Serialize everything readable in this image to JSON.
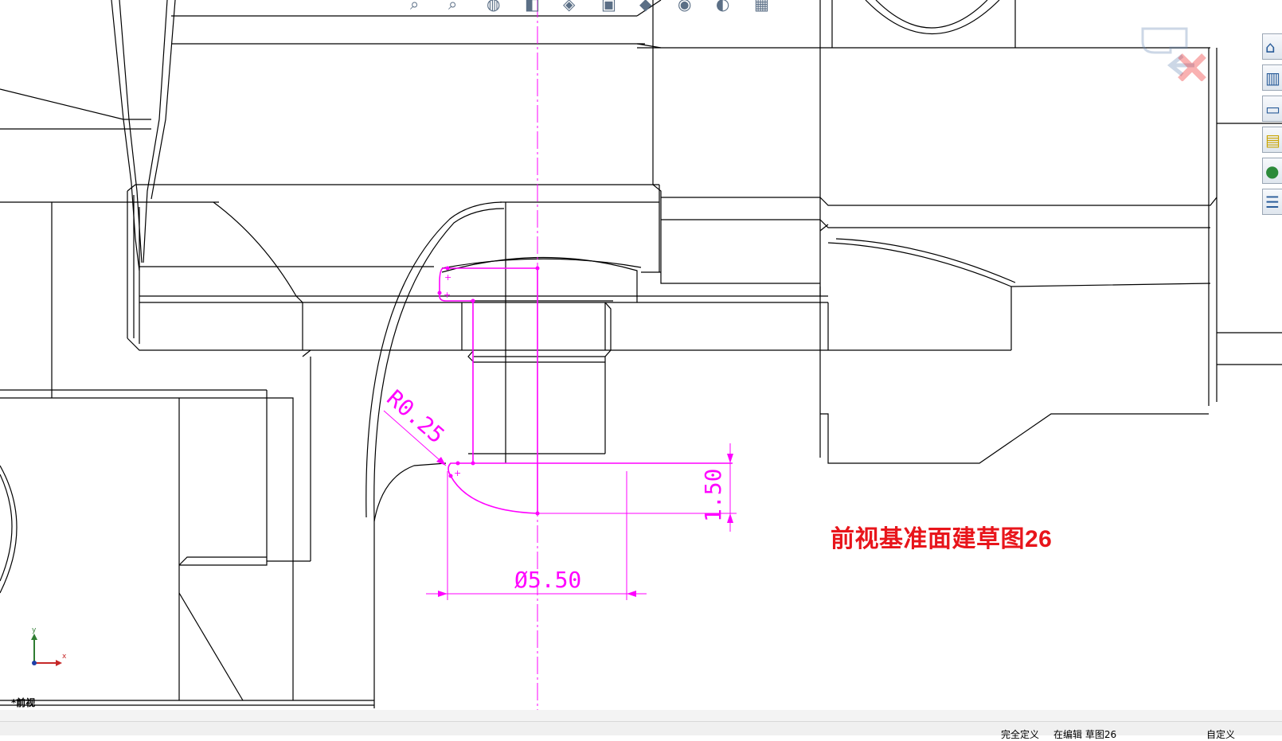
{
  "annotation": "前视基准面建草图26",
  "view_label": "*前视",
  "dimensions": {
    "radius": "R0.25",
    "height": "1.50",
    "diameter": "Ø5.50"
  },
  "triad": {
    "x_label": "x",
    "y_label": "y"
  },
  "status_bar": {
    "definition_state": "完全定义",
    "editing": "在编辑 草图26",
    "units": "自定义"
  },
  "toolbar": {
    "icons": [
      "zoom-to-fit-icon",
      "zoom-area-icon",
      "previous-view-icon",
      "section-view-icon",
      "view-orientation-icon",
      "display-style-icon",
      "hide-show-icon",
      "edit-appearance-icon",
      "apply-scene-icon",
      "view-settings-icon"
    ]
  },
  "task_pane": {
    "icons": [
      "home-icon",
      "design-library-icon",
      "file-explorer-icon",
      "view-palette-icon",
      "appearances-icon",
      "custom-properties-icon"
    ]
  },
  "confirm_corner": {
    "icons": [
      "exit-sketch-icon",
      "cancel-sketch-icon"
    ]
  },
  "colors": {
    "sketch": "#ff00ff",
    "annotation": "#e8151b",
    "edges": "#000000"
  }
}
